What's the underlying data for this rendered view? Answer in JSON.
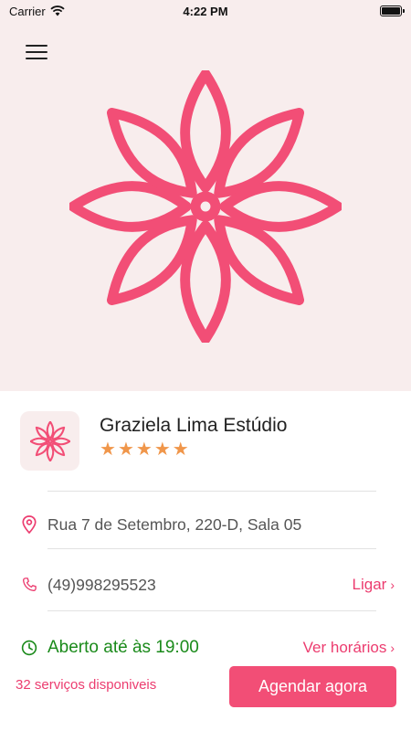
{
  "status_bar": {
    "carrier": "Carrier",
    "time": "4:22 PM"
  },
  "hero": {
    "menu_icon": "hamburger-menu-icon",
    "image_icon": "lotus-flower-icon"
  },
  "business": {
    "logo_icon": "lotus-flower-icon",
    "name": "Graziela Lima Estúdio",
    "rating": 5,
    "rating_max": 5,
    "stars": [
      "★",
      "★",
      "★",
      "★",
      "★"
    ]
  },
  "contact": {
    "address": "Rua 7 de Setembro, 220-D, Sala 05",
    "phone": "(49)998295523",
    "call_label": "Ligar",
    "open_status": "Aberto até às 19:00",
    "hours_label": "Ver horários"
  },
  "footer": {
    "services_count": "32 serviços disponiveis",
    "book_label": "Agendar agora"
  },
  "colors": {
    "accent": "#f24e76",
    "link": "#ec3c6f",
    "open_green": "#1a8a1a",
    "stars": "#f0964a",
    "hero_bg": "#f8eded"
  }
}
